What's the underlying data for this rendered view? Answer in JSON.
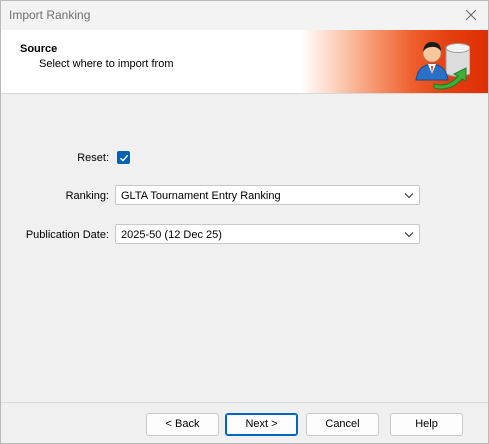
{
  "window": {
    "title": "Import Ranking"
  },
  "header": {
    "title": "Source",
    "subtitle": "Select where to import from"
  },
  "form": {
    "reset_label": "Reset:",
    "reset_checked": true,
    "ranking_label": "Ranking:",
    "ranking_value": "GLTA Tournament Entry Ranking",
    "publication_date_label": "Publication Date:",
    "publication_date_value": "2025-50 (12 Dec 25)"
  },
  "buttons": {
    "back": "< Back",
    "next": "Next >",
    "cancel": "Cancel",
    "help": "Help"
  },
  "icons": {
    "close": "close-icon",
    "header": "user-database-import-icon",
    "checkbox": "checkmark-icon",
    "dropdown": "chevron-down-icon"
  },
  "colors": {
    "accent": "#0067c0",
    "header_gradient_end": "#de2f06"
  }
}
